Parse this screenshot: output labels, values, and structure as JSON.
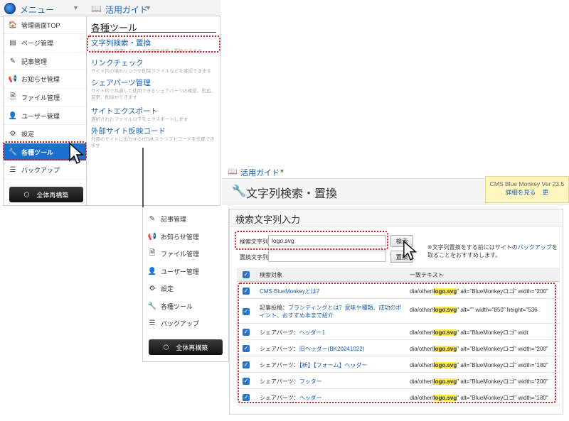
{
  "top": {
    "menu_label": "メニュー",
    "guide_label": "活用ガイド"
  },
  "sidebar": {
    "items": [
      {
        "icon": "home-icon",
        "glyph": "🏠",
        "label": "管理画面TOP"
      },
      {
        "icon": "page-icon",
        "glyph": "▤",
        "label": "ページ管理"
      },
      {
        "icon": "edit-icon",
        "glyph": "✎",
        "label": "記事管理"
      },
      {
        "icon": "megaphone-icon",
        "glyph": "📢",
        "label": "お知らせ管理"
      },
      {
        "icon": "file-icon",
        "glyph": "🗎",
        "label": "ファイル管理"
      },
      {
        "icon": "user-icon",
        "glyph": "👤",
        "label": "ユーザー管理"
      },
      {
        "icon": "gear-icon",
        "glyph": "⚙",
        "label": "設定"
      },
      {
        "icon": "wrench-icon",
        "glyph": "🔧",
        "label": "各種ツール"
      },
      {
        "icon": "database-icon",
        "glyph": "☰",
        "label": "バックアップ"
      }
    ],
    "rebuild_label": "全体再構築"
  },
  "tools": {
    "heading": "各種ツール",
    "items": [
      {
        "title": "文字列検索・置換",
        "desc": "サイト内に使用している文字列を検索・置換できます"
      },
      {
        "title": "リンクチェック",
        "desc": "サイト内の壊れリンクや削除ファイルなどを確認できます"
      },
      {
        "title": "シェアパーツ管理",
        "desc": "サイト内で共通して使用できるシェアパーツの確認、追加、変更、削除ができます"
      },
      {
        "title": "サイトエクスポート",
        "desc": "選択されたファイル以下をエクスポートします"
      },
      {
        "title": "外部サイト反映コード",
        "desc": "外部のサイトに出力するHTMLスクリプトコードを作成できます"
      }
    ]
  },
  "sidebar2": {
    "items": [
      {
        "icon": "edit-icon",
        "glyph": "✎",
        "label": "記事管理"
      },
      {
        "icon": "megaphone-icon",
        "glyph": "📢",
        "label": "お知らせ管理"
      },
      {
        "icon": "file-icon",
        "glyph": "🗎",
        "label": "ファイル管理"
      },
      {
        "icon": "user-icon",
        "glyph": "👤",
        "label": "ユーザー管理"
      },
      {
        "icon": "gear-icon",
        "glyph": "⚙",
        "label": "設定"
      },
      {
        "icon": "wrench-icon",
        "glyph": "🔧",
        "label": "各種ツール"
      },
      {
        "icon": "database-icon",
        "glyph": "☰",
        "label": "バックアップ"
      }
    ],
    "rebuild_label": "全体再構築"
  },
  "main": {
    "guide_label": "活用ガイド",
    "page_title": "文字列検索・置換",
    "version_line": "CMS Blue Monkey Ver 23.5",
    "version_link": "詳細を見る",
    "version_link2": "更",
    "panel_title": "検索文字列入力",
    "search_label": "検索文字列",
    "search_value": "logo.svg",
    "search_button": "検索",
    "replace_label": "置換文字列",
    "replace_value": "",
    "replace_button": "置換",
    "note_pre": "※文字列置換をする前にはサイトの",
    "note_link": "バックアップ",
    "note_post": "を取ることをおすすめします。",
    "col_target": "検索対象",
    "col_match": "一致テキスト",
    "rows": [
      {
        "prefix": "",
        "link": "CMS BlueMonkeyとは？",
        "pre": "dia/other/",
        "hl": "logo.svg",
        "post": "\" alt=\"BlueMonkeyロゴ\" width=\"200\""
      },
      {
        "prefix": "記事投稿：",
        "link": "ブランディングとは？意味や種類、成功のポイント、おすすめ本まで紹介",
        "pre": "dia/other/",
        "hl": "logo.svg",
        "post": "\" alt=\"\" width=\"850\" height=\"536"
      },
      {
        "prefix": "シェアパーツ：",
        "link": "ヘッダー1",
        "pre": "dia/other/",
        "hl": "logo.svg",
        "post": "\" alt=\"BlueMonkeyロゴ\" widt"
      },
      {
        "prefix": "シェアパーツ：",
        "link": "旧ヘッダー(BK20241022)",
        "pre": "dia/other/",
        "hl": "logo.svg",
        "post": "\" alt=\"BlueMonkeyロゴ\" width=\"200\""
      },
      {
        "prefix": "シェアパーツ：",
        "link": "【新】【フォーム】ヘッダー",
        "pre": "dia/other/",
        "hl": "logo.svg",
        "post": "\" alt=\"BlueMonkeyロゴ\" width=\"180\""
      },
      {
        "prefix": "シェアパーツ：",
        "link": "フッター",
        "pre": "dia/other/",
        "hl": "logo.svg",
        "post": "\" alt=\"BlueMonkeyロゴ\" width=\"200\""
      },
      {
        "prefix": "シェアパーツ：",
        "link": "ヘッダー",
        "pre": "dia/other/",
        "hl": "logo.svg",
        "post": "\" alt=\"BlueMonkeyロゴ\" width=\"180\""
      }
    ]
  },
  "colors": {
    "accent": "#1a5fb4",
    "active": "#1a6fd0",
    "highlight": "#d0161a",
    "match": "#ffe94d"
  }
}
